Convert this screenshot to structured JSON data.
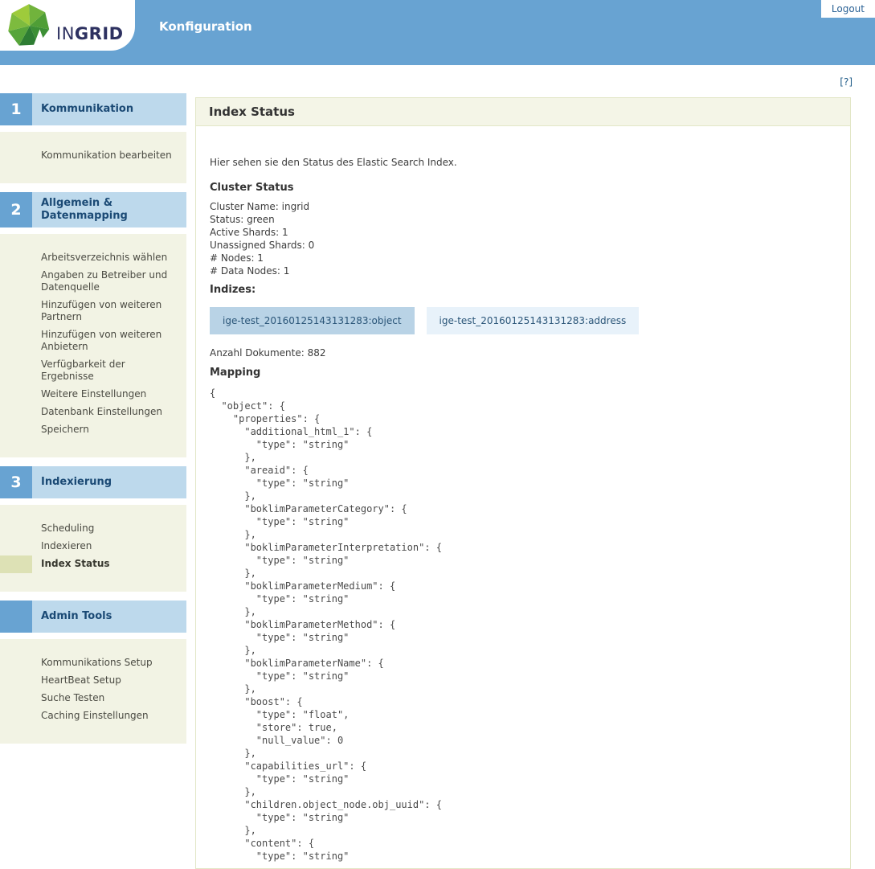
{
  "header": {
    "logo_text_light": "IN",
    "logo_text_bold": "GRID",
    "app_title": "Konfiguration",
    "logout_label": "Logout"
  },
  "help_link_label": "[?]",
  "sidebar": {
    "sections": [
      {
        "number": "1",
        "title": "Kommunikation",
        "items": [
          {
            "label": "Kommunikation bearbeiten",
            "active": false
          }
        ]
      },
      {
        "number": "2",
        "title": "Allgemein & Datenmapping",
        "items": [
          {
            "label": "Arbeitsverzeichnis wählen",
            "active": false
          },
          {
            "label": "Angaben zu Betreiber und Datenquelle",
            "active": false
          },
          {
            "label": "Hinzufügen von weiteren Partnern",
            "active": false
          },
          {
            "label": "Hinzufügen von weiteren Anbietern",
            "active": false
          },
          {
            "label": "Verfügbarkeit der Ergebnisse",
            "active": false
          },
          {
            "label": "Weitere Einstellungen",
            "active": false
          },
          {
            "label": "Datenbank Einstellungen",
            "active": false
          },
          {
            "label": "Speichern",
            "active": false
          }
        ]
      },
      {
        "number": "3",
        "title": "Indexierung",
        "items": [
          {
            "label": "Scheduling",
            "active": false
          },
          {
            "label": "Indexieren",
            "active": false
          },
          {
            "label": "Index Status",
            "active": true
          }
        ]
      },
      {
        "number": "",
        "title": "Admin Tools",
        "items": [
          {
            "label": "Kommunikations Setup",
            "active": false
          },
          {
            "label": "HeartBeat Setup",
            "active": false
          },
          {
            "label": "Suche Testen",
            "active": false
          },
          {
            "label": "Caching Einstellungen",
            "active": false
          }
        ]
      }
    ]
  },
  "main": {
    "panel_title": "Index Status",
    "intro": "Hier sehen sie den Status des Elastic Search Index.",
    "cluster": {
      "heading": "Cluster Status",
      "lines": [
        "Cluster Name: ingrid",
        "Status: green",
        "Active Shards: 1",
        "Unassigned Shards: 0",
        "# Nodes: 1",
        "# Data Nodes: 1"
      ]
    },
    "indices": {
      "heading": "Indizes:",
      "tabs": [
        {
          "label": "ige-test_20160125143131283:object",
          "selected": true
        },
        {
          "label": "ige-test_20160125143131283:address",
          "selected": false
        }
      ],
      "doc_count": "Anzahl Dokumente: 882"
    },
    "mapping": {
      "heading": "Mapping",
      "lines": [
        "{",
        "  \"object\": {",
        "    \"properties\": {",
        "      \"additional_html_1\": {",
        "        \"type\": \"string\"",
        "      },",
        "      \"areaid\": {",
        "        \"type\": \"string\"",
        "      },",
        "      \"boklimParameterCategory\": {",
        "        \"type\": \"string\"",
        "      },",
        "      \"boklimParameterInterpretation\": {",
        "        \"type\": \"string\"",
        "      },",
        "      \"boklimParameterMedium\": {",
        "        \"type\": \"string\"",
        "      },",
        "      \"boklimParameterMethod\": {",
        "        \"type\": \"string\"",
        "      },",
        "      \"boklimParameterName\": {",
        "        \"type\": \"string\"",
        "      },",
        "      \"boost\": {",
        "        \"type\": \"float\",",
        "        \"store\": true,",
        "        \"null_value\": 0",
        "      },",
        "      \"capabilities_url\": {",
        "        \"type\": \"string\"",
        "      },",
        "      \"children.object_node.obj_uuid\": {",
        "        \"type\": \"string\"",
        "      },",
        "      \"content\": {",
        "        \"type\": \"string\""
      ]
    }
  },
  "colors": {
    "header_blue": "#68a3d2",
    "section_bar_blue": "#bdd9ec",
    "section_title_text": "#1b4a75",
    "sidebar_panel_bg": "#f2f3e4",
    "active_item_highlight": "#dde1b5",
    "panel_titlebar_bg": "#f4f5e7",
    "panel_border": "#e2e6c6",
    "tab_selected_bg": "#b9d3e6",
    "tab_unselected_bg": "#e8f2fa",
    "logo_navy": "#2d3160"
  }
}
